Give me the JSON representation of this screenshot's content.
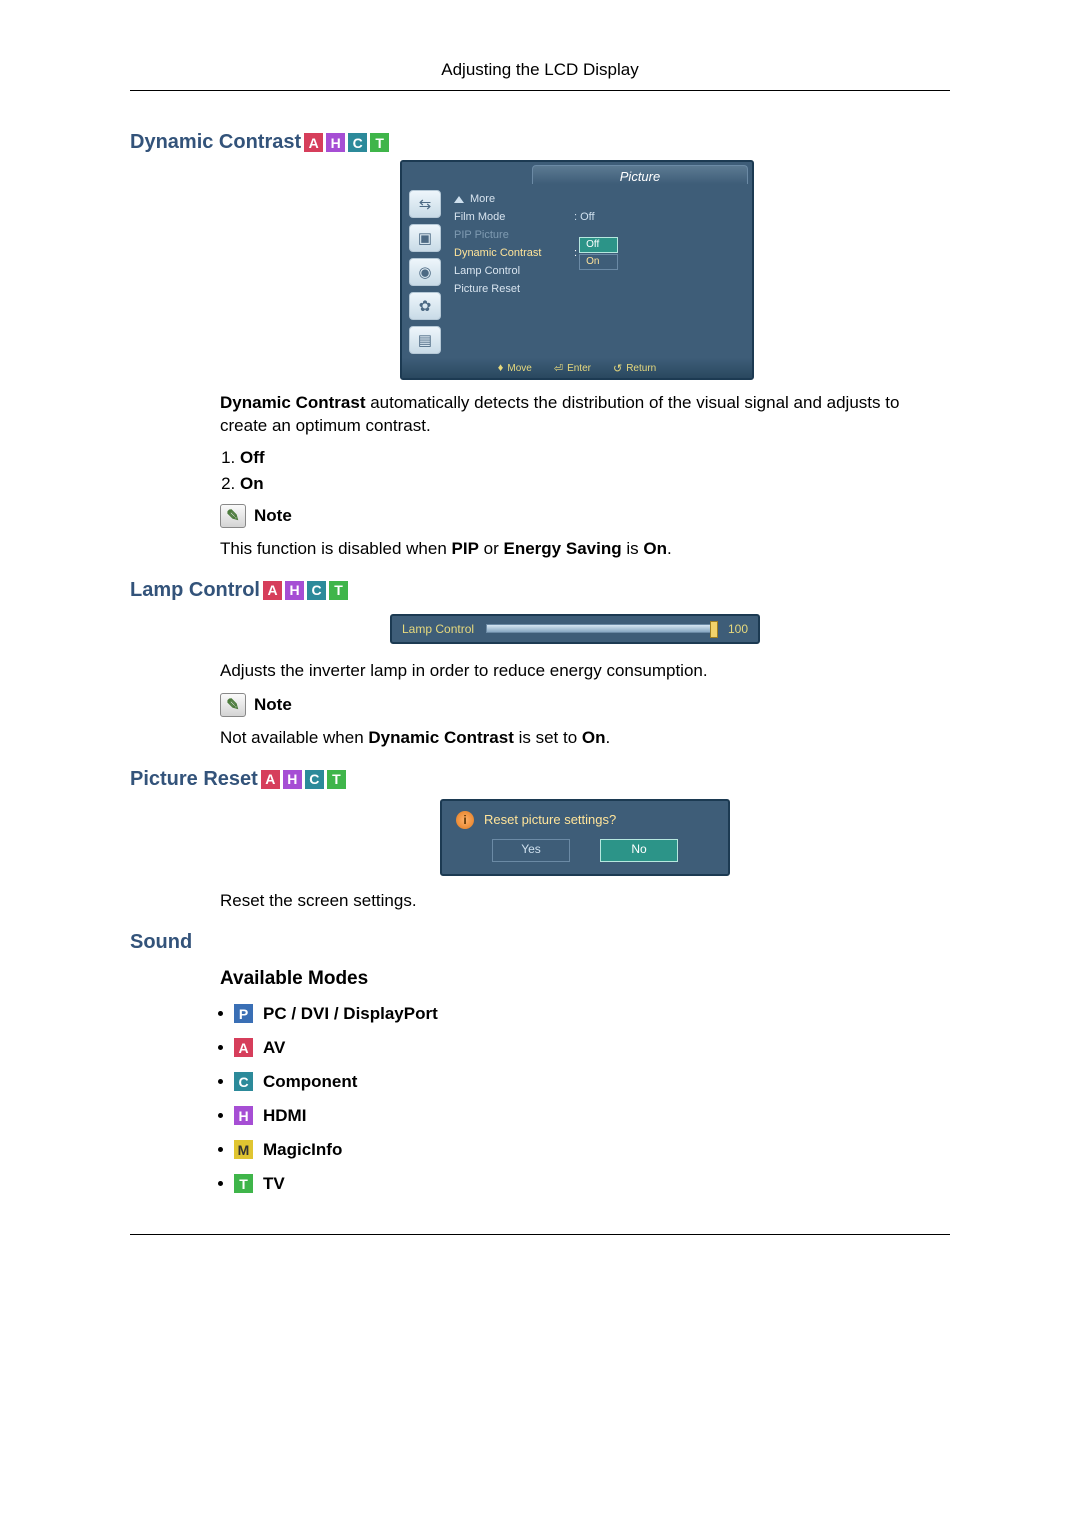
{
  "header": {
    "title": "Adjusting the LCD Display"
  },
  "badges": {
    "A": "A",
    "H": "H",
    "C": "C",
    "T": "T",
    "P": "P",
    "M": "M"
  },
  "dc": {
    "heading": "Dynamic Contrast",
    "desc_lead": "Dynamic Contrast",
    "desc_rest": " automatically detects the distribution of the visual signal and adjusts to create an optimum contrast.",
    "items": [
      "Off",
      "On"
    ],
    "note_label": "Note",
    "note_text_1": "This function is disabled when ",
    "note_b1": "PIP",
    "note_text_2": " or ",
    "note_b2": "Energy Saving",
    "note_text_3": " is ",
    "note_b3": "On",
    "note_text_4": "."
  },
  "osd": {
    "title": "Picture",
    "rows": {
      "more": "More",
      "film_mode": "Film Mode",
      "film_mode_val": ": Off",
      "pip_picture": "PIP Picture",
      "dyn_contrast": "Dynamic Contrast",
      "dc_opt_off": "Off",
      "dc_opt_on": "On",
      "lamp_control": "Lamp Control",
      "picture_reset": "Picture Reset"
    },
    "footer": {
      "move": "Move",
      "enter": "Enter",
      "return": "Return"
    }
  },
  "lamp": {
    "heading": "Lamp Control",
    "bar_label": "Lamp Control",
    "bar_value": "100",
    "desc": "Adjusts the inverter lamp in order to reduce energy consumption.",
    "note_label": "Note",
    "note_text_1": "Not available when ",
    "note_b1": "Dynamic Contrast",
    "note_text_2": " is set to ",
    "note_b2": "On",
    "note_text_3": "."
  },
  "preset": {
    "heading": "Picture Reset",
    "dlg_text": "Reset picture settings?",
    "yes": "Yes",
    "no": "No",
    "desc": "Reset the screen settings."
  },
  "sound": {
    "heading": "Sound",
    "sub": "Available Modes",
    "modes": {
      "pc": "PC / DVI / DisplayPort",
      "av": "AV",
      "component": "Component",
      "hdmi": "HDMI",
      "magicinfo": "MagicInfo",
      "tv": "TV"
    }
  }
}
